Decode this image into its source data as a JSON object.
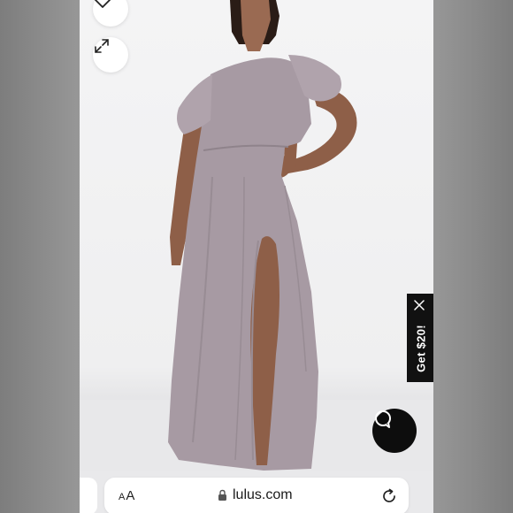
{
  "page": {
    "promo_label": "Get $20!",
    "url": "lulus.com",
    "text_size_small": "A",
    "text_size_large": "A"
  },
  "icons": {
    "wishlist": "heart-icon",
    "expand": "expand-arrows-icon",
    "promo_close": "close-icon",
    "chat": "chat-bubble-icon",
    "secure": "lock-icon",
    "reload": "reload-icon"
  },
  "colors": {
    "dress": "#a79aa3",
    "promo_background": "#111111",
    "chat_button": "#0d0d0d"
  }
}
